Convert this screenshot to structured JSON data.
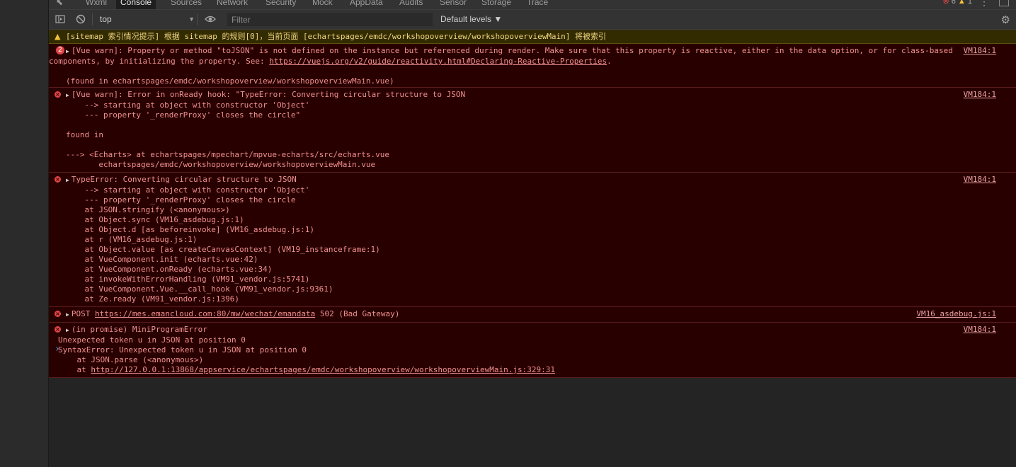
{
  "tabs": [
    "Wxml",
    "Console",
    "Sources",
    "Network",
    "Security",
    "Mock",
    "AppData",
    "Audits",
    "Sensor",
    "Storage",
    "Trace"
  ],
  "active_tab": "Console",
  "status": {
    "errors": "6",
    "warnings": "1"
  },
  "toolbar": {
    "context": "top",
    "filter_placeholder": "Filter",
    "levels": "Default levels ▼"
  },
  "messages": {
    "sitemap": "[sitemap 索引情况提示] 根据 sitemap 的规则[0]，当前页面 [echartspages/emdc/workshopoverview/workshopoverviewMain] 将被索引",
    "m1": {
      "count": "2",
      "line1": "[Vue warn]: Property or method \"toJSON\" is not defined on the instance but referenced during render. Make sure that this property is reactive, either in the data option, or for class-based",
      "line2_prefix": "components, by initializing the property. See: ",
      "line2_link": "https://vuejs.org/v2/guide/reactivity.html#Declaring-Reactive-Properties",
      "line2_suffix": ".",
      "line3": "",
      "line4": "(found in echartspages/emdc/workshopoverview/workshopoverviewMain.vue)",
      "src": "VM184:1"
    },
    "m2": {
      "lines": [
        "[Vue warn]: Error in onReady hook: \"TypeError: Converting circular structure to JSON",
        "    --> starting at object with constructor 'Object'",
        "    --- property '_renderProxy' closes the circle\"",
        "",
        "found in",
        "",
        "---> <Echarts> at echartspages/mpechart/mpvue-echarts/src/echarts.vue",
        "       echartspages/emdc/workshopoverview/workshopoverviewMain.vue"
      ],
      "src": "VM184:1"
    },
    "m3": {
      "lines": [
        "TypeError: Converting circular structure to JSON",
        "    --> starting at object with constructor 'Object'",
        "    --- property '_renderProxy' closes the circle",
        "    at JSON.stringify (<anonymous>)",
        "    at Object.sync (VM16_asdebug.js:1)",
        "    at Object.d [as beforeinvoke] (VM16_asdebug.js:1)",
        "    at r (VM16_asdebug.js:1)",
        "    at Object.value [as createCanvasContext] (VM19_instanceframe:1)",
        "    at VueComponent.init (echarts.vue:42)",
        "    at VueComponent.onReady (echarts.vue:34)",
        "    at invokeWithErrorHandling (VM91_vendor.js:5741)",
        "    at VueComponent.Vue.__call_hook (VM91_vendor.js:9361)",
        "    at Ze.ready (VM91_vendor.js:1396)"
      ],
      "src": "VM184:1"
    },
    "m4": {
      "prefix": "POST ",
      "link": "https://mes.emancloud.com:80/mw/wechat/emandata",
      "suffix": " 502 (Bad Gateway)",
      "src": "VM16_asdebug.js:1"
    },
    "m5": {
      "lines": [
        "(in promise) MiniProgramError",
        "Unexpected token u in JSON at position 0",
        "SyntaxError: Unexpected token u in JSON at position 0",
        "    at JSON.parse (<anonymous>)"
      ],
      "last_prefix": "    at ",
      "last_link": "http://127.0.0.1:13868/appservice/echartspages/emdc/workshopoverview/workshopoverviewMain.js:329:31",
      "src": "VM184:1"
    }
  },
  "prompt": "›"
}
